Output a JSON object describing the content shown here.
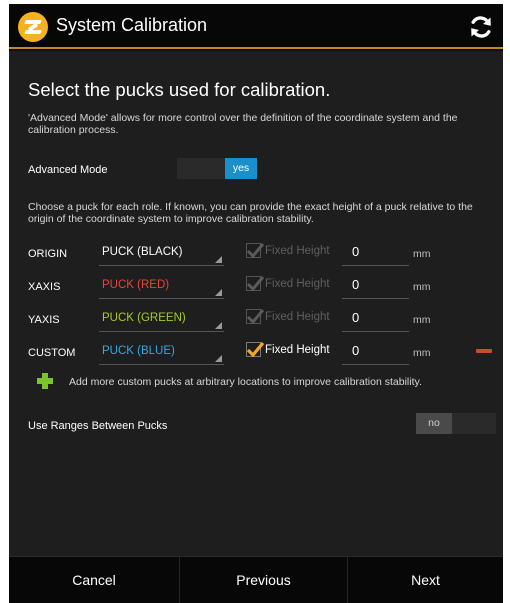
{
  "header": {
    "title": "System Calibration",
    "logo_icon": "skyline-logo-icon",
    "refresh_icon": "refresh-icon",
    "accent_color": "#c48a1d"
  },
  "content": {
    "heading": "Select the pucks used for calibration.",
    "advanced_desc": "'Advanced Mode' allows for more control over the definition of the coordinate system and the calibration process.",
    "advanced_label": "Advanced Mode",
    "advanced_toggle": "yes",
    "puck_desc": "Choose a puck for each role. If known, you can provide the exact height of a puck relative to the origin of the coordinate system to improve calibration stability.",
    "fixed_height_label": "Fixed Height",
    "unit": "mm",
    "rows": [
      {
        "role": "ORIGIN",
        "puck": "PUCK (BLACK)",
        "puck_color": "#ffffff",
        "fixed_height": true,
        "enabled": false,
        "height": "0"
      },
      {
        "role": "XAXIS",
        "puck": "PUCK (RED)",
        "puck_color": "#e8453a",
        "fixed_height": true,
        "enabled": false,
        "height": "0"
      },
      {
        "role": "YAXIS",
        "puck": "PUCK (GREEN)",
        "puck_color": "#a6cc2a",
        "fixed_height": true,
        "enabled": false,
        "height": "0"
      },
      {
        "role": "CUSTOM",
        "puck": "PUCK (BLUE)",
        "puck_color": "#33a9e0",
        "fixed_height": true,
        "enabled": true,
        "height": "0"
      }
    ],
    "add_text": "Add more custom pucks at arbitrary locations to improve calibration stability.",
    "ranges_label": "Use Ranges Between Pucks",
    "ranges_toggle": "no"
  },
  "footer": {
    "cancel": "Cancel",
    "previous": "Previous",
    "next": "Next"
  }
}
